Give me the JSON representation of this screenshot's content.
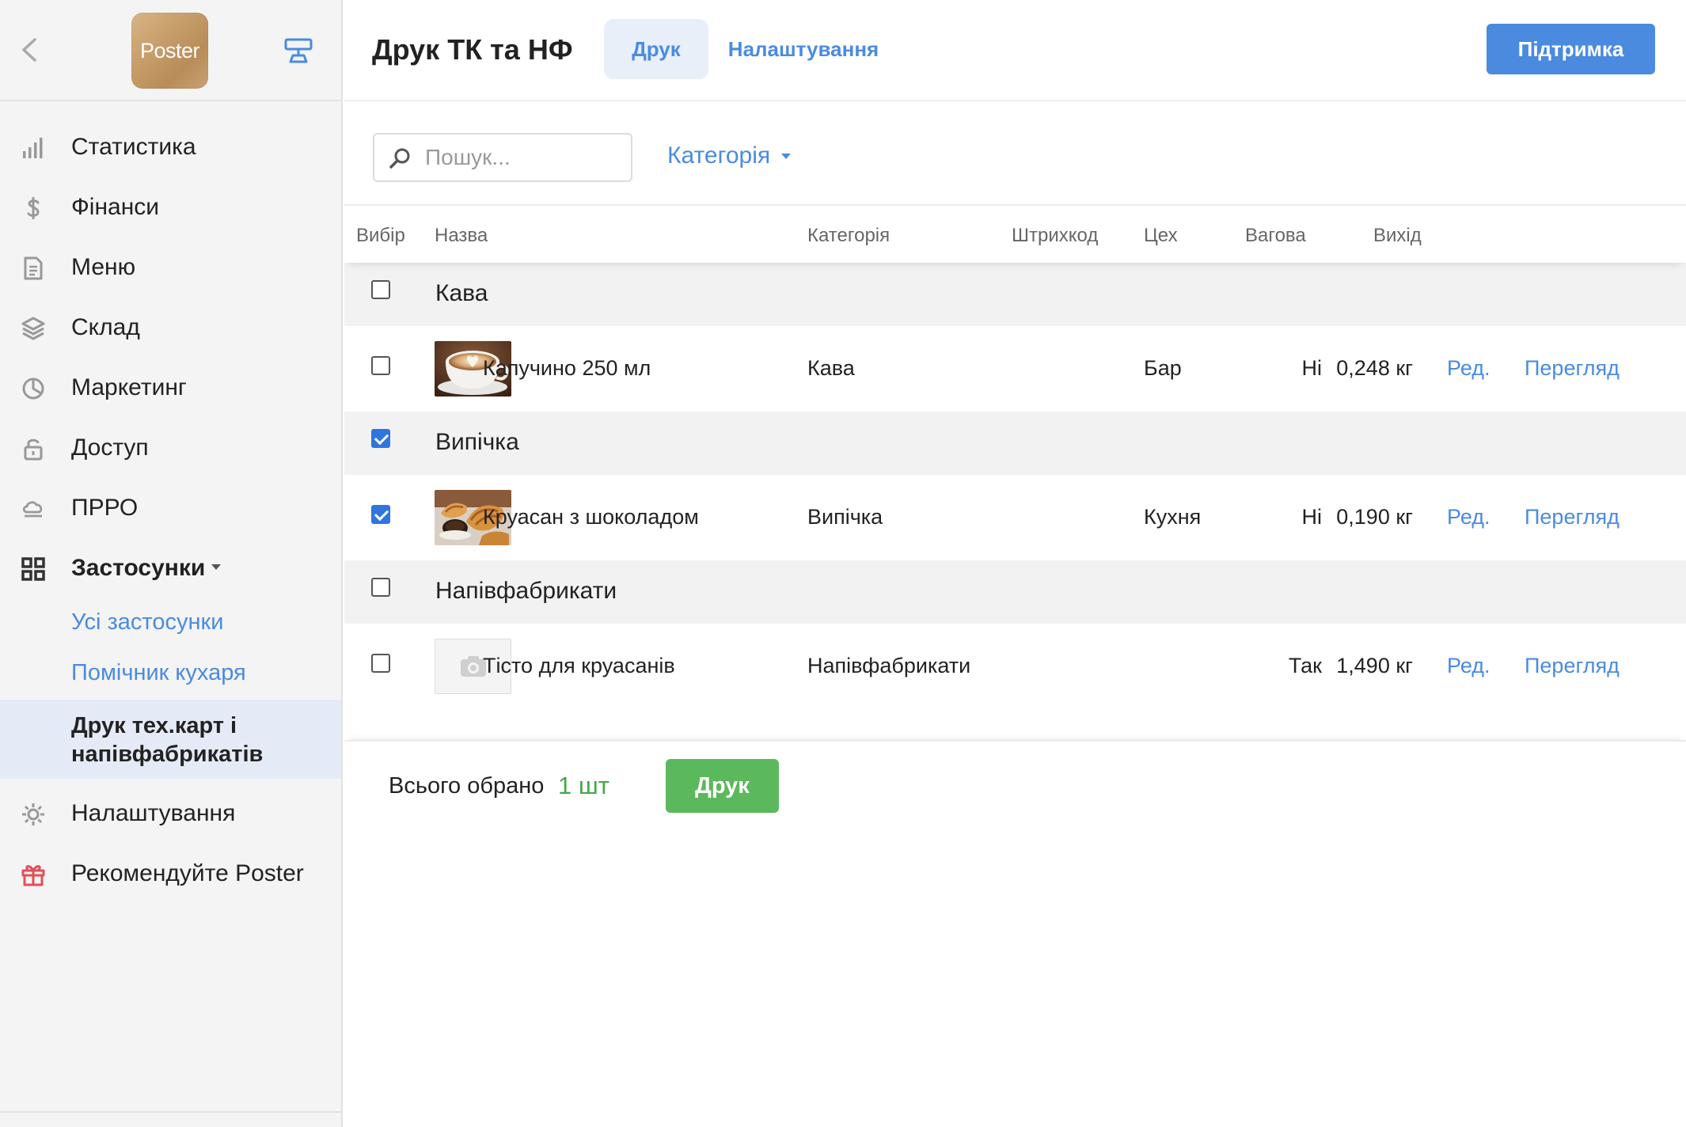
{
  "app": {
    "logo_text": "Poster"
  },
  "sidebar": {
    "items": [
      {
        "label": "Статистика",
        "icon": "bar-chart-icon"
      },
      {
        "label": "Фінанси",
        "icon": "dollar-icon"
      },
      {
        "label": "Меню",
        "icon": "document-icon"
      },
      {
        "label": "Склад",
        "icon": "layers-icon"
      },
      {
        "label": "Маркетинг",
        "icon": "pie-icon"
      },
      {
        "label": "Доступ",
        "icon": "lock-icon"
      },
      {
        "label": "ПРРО",
        "icon": "cloud-icon"
      },
      {
        "label": "Застосунки",
        "icon": "apps-grid-icon"
      }
    ],
    "apps_sub": [
      {
        "label": "Усі застосунки"
      },
      {
        "label": "Помічник кухаря"
      },
      {
        "label": "Друк тех.карт і напівфабрикатів"
      }
    ],
    "bottom_items": [
      {
        "label": "Налаштування",
        "icon": "gear-icon"
      },
      {
        "label": "Рекомендуйте Poster",
        "icon": "gift-icon"
      }
    ]
  },
  "header": {
    "title": "Друк ТК та НФ",
    "tabs": [
      {
        "label": "Друк",
        "active": true
      },
      {
        "label": "Налаштування",
        "active": false
      }
    ],
    "support_label": "Підтримка"
  },
  "toolbar": {
    "search_placeholder": "Пошук...",
    "search_value": "",
    "category_label": "Категорія"
  },
  "table": {
    "columns": [
      "Вибір",
      "Назва",
      "Категорія",
      "Штрихкод",
      "Цех",
      "Вагова",
      "Вихід"
    ],
    "groups": [
      {
        "name": "Кава",
        "checked": false,
        "items": [
          {
            "name": "Капучино 250 мл",
            "category": "Кава",
            "barcode": "",
            "workshop": "Бар",
            "weighted": "Ні",
            "output": "0,248 кг",
            "image": "cappuccino",
            "checked": false,
            "edit": "Ред.",
            "view": "Перегляд"
          }
        ]
      },
      {
        "name": "Випічка",
        "checked": true,
        "items": [
          {
            "name": "Круасан з шоколадом",
            "category": "Випічка",
            "barcode": "",
            "workshop": "Кухня",
            "weighted": "Ні",
            "output": "0,190 кг",
            "image": "croissant",
            "checked": true,
            "edit": "Ред.",
            "view": "Перегляд"
          }
        ]
      },
      {
        "name": "Напівфабрикати",
        "checked": false,
        "items": [
          {
            "name": "Тісто для круасанів",
            "category": "Напівфабрикати",
            "barcode": "",
            "workshop": "",
            "weighted": "Так",
            "output": "1,490 кг",
            "image": "placeholder",
            "checked": false,
            "edit": "Ред.",
            "view": "Перегляд"
          }
        ]
      }
    ]
  },
  "footer": {
    "total_label": "Всього обрано",
    "total_count": "1 шт",
    "print_label": "Друк"
  },
  "colors": {
    "accent": "#4a8be0",
    "print_green": "#5cb85c",
    "count_green": "#43a84a",
    "checkbox_blue": "#2f75e0",
    "gift_red": "#e0505a"
  }
}
